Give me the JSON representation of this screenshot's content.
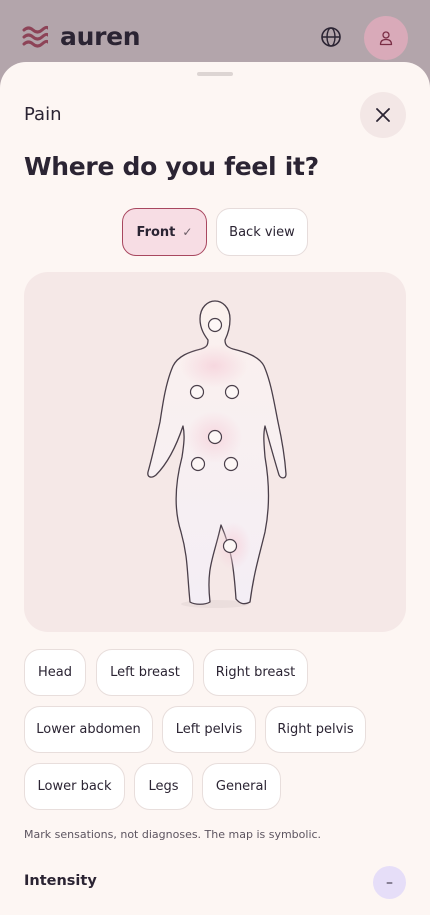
{
  "app": {
    "name": "auren"
  },
  "header": {
    "logo_icon": "waves-icon",
    "language_icon": "globe-icon",
    "profile_icon": "user-icon"
  },
  "sheet": {
    "title": "Pain",
    "close_icon": "close-icon",
    "question": "Where do you feel it?",
    "view_toggle": {
      "front_label": "Front",
      "front_check": "✓",
      "back_label": "Back view",
      "selected": "Front"
    },
    "body_map": {
      "view": "front",
      "markers": [
        "head",
        "left-breast",
        "right-breast",
        "abdomen",
        "left-pelvis",
        "right-pelvis",
        "legs"
      ]
    },
    "regions": [
      "Head",
      "Left breast",
      "Right breast",
      "Lower abdomen",
      "Left pelvis",
      "Right pelvis",
      "Lower back",
      "Legs",
      "General"
    ],
    "disclaimer": "Mark sensations, not diagnoses. The map is symbolic.",
    "intensity": {
      "title": "Intensity",
      "toggle_symbol": "–"
    }
  },
  "colors": {
    "accent": "#a8475f",
    "selected_fill": "#f7dde4",
    "sheet_bg": "#fdf6f3",
    "avatar_bg": "#d9aab9",
    "collapse_bg": "#e6def8"
  }
}
